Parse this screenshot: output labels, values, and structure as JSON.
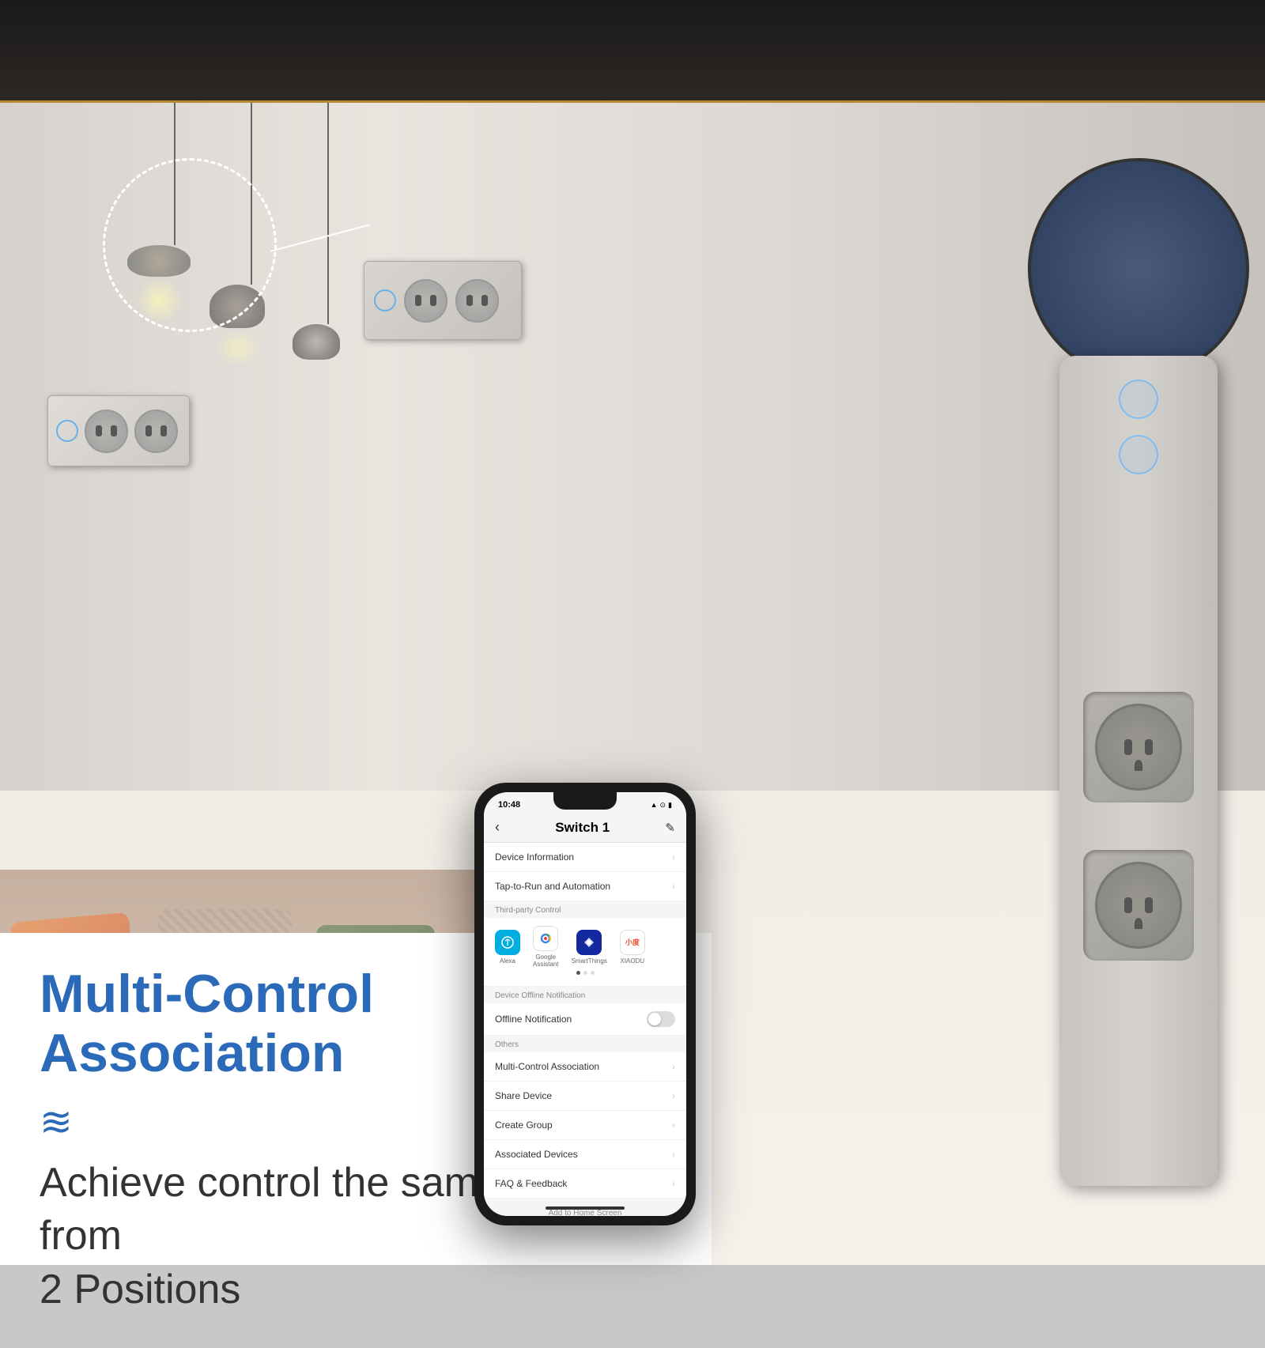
{
  "background": {
    "alt": "Smart home living room"
  },
  "annotation": {
    "dashed_circle": "Pendant light annotation circle",
    "arrow_line": "Arrow pointing to switch panel"
  },
  "switch_panel_left": {
    "label": "Smart switch panel left wall"
  },
  "switch_panel_center": {
    "label": "Smart switch panel center wall"
  },
  "bottom_section": {
    "title": "Multi-Control Association",
    "wave": "≋",
    "subtitle_line1": "Achieve control the same light from",
    "subtitle_line2": "2 Positions"
  },
  "phone": {
    "status_bar": {
      "time": "10:48",
      "signal": "●●●",
      "wifi": "▲",
      "battery": "■"
    },
    "header": {
      "back": "‹",
      "title": "Switch 1",
      "edit": "✎"
    },
    "menu_items": [
      {
        "label": "Device Information",
        "has_chevron": true
      },
      {
        "label": "Tap-to-Run and Automation",
        "has_chevron": true
      }
    ],
    "third_party_section_label": "Third-party Control",
    "third_party_services": [
      {
        "name": "Alexa",
        "icon_type": "alexa"
      },
      {
        "name": "Google Assistant",
        "icon_type": "google",
        "short": "Google\nAssistant"
      },
      {
        "name": "SmartThings",
        "icon_type": "smartthings"
      },
      {
        "name": "XIAODU",
        "icon_type": "xiaodu"
      }
    ],
    "notification_section_label": "Device Offline Notification",
    "offline_notification_label": "Offline Notification",
    "others_section_label": "Others",
    "other_items": [
      {
        "label": "Multi-Control Association",
        "has_chevron": true
      },
      {
        "label": "Share Device",
        "has_chevron": true
      },
      {
        "label": "Create Group",
        "has_chevron": true
      },
      {
        "label": "Associated Devices",
        "has_chevron": true
      },
      {
        "label": "FAQ & Feedback",
        "has_chevron": true
      }
    ],
    "add_home_label": "Add to Home Screen",
    "device_title": "Switch 1"
  },
  "smart_switch_device": {
    "label": "Smart wall switch with outlets"
  },
  "colors": {
    "accent_blue": "#2a6ab8",
    "touch_ring": "rgba(100,180,255,0.7)",
    "panel_bg": "#d0cdc8"
  }
}
